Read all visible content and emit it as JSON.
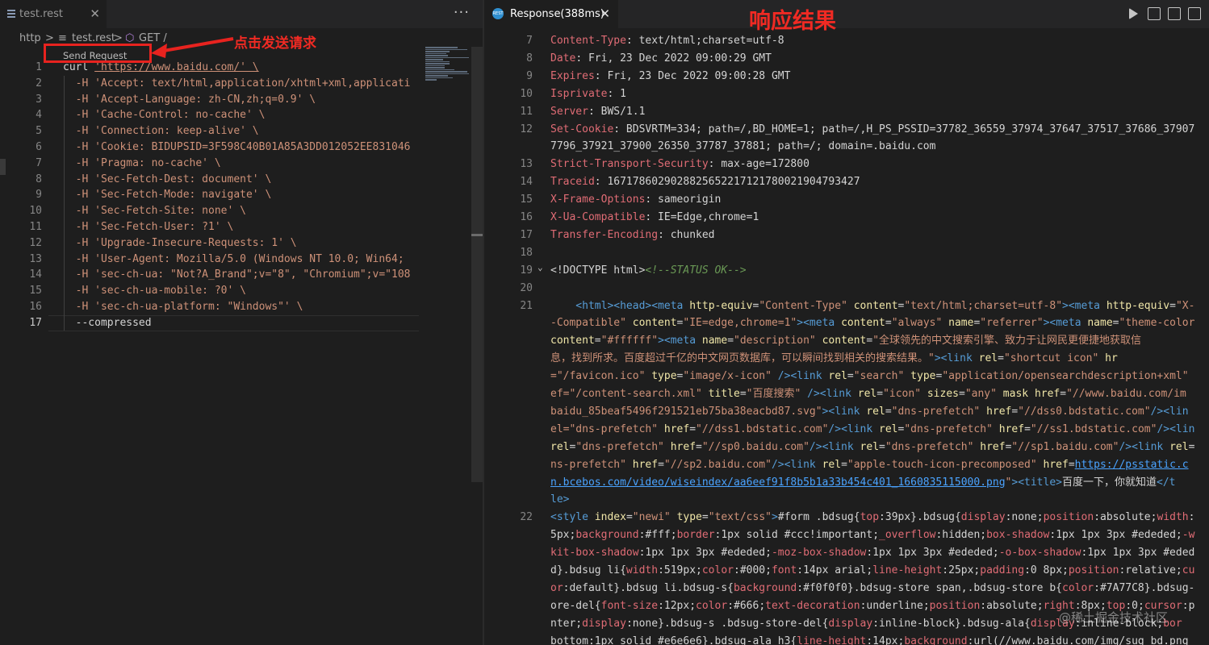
{
  "left": {
    "tab_label": "test.rest",
    "tab_close": "✕",
    "more": "···",
    "breadcrumb": [
      "http",
      ">",
      "≡",
      "test.rest",
      ">",
      "GET /"
    ],
    "codelens": "Send Request",
    "annotation": "点击发送请求",
    "lines": [
      {
        "n": "1",
        "t": "curl 'https://www.baidu.com/' \\"
      },
      {
        "n": "2",
        "t": "  -H 'Accept: text/html,application/xhtml+xml,applicati"
      },
      {
        "n": "3",
        "t": "  -H 'Accept-Language: zh-CN,zh;q=0.9' \\"
      },
      {
        "n": "4",
        "t": "  -H 'Cache-Control: no-cache' \\"
      },
      {
        "n": "5",
        "t": "  -H 'Connection: keep-alive' \\"
      },
      {
        "n": "6",
        "t": "  -H 'Cookie: BIDUPSID=3F598C40B01A85A3DD012052EE831046"
      },
      {
        "n": "7",
        "t": "  -H 'Pragma: no-cache' \\"
      },
      {
        "n": "8",
        "t": "  -H 'Sec-Fetch-Dest: document' \\"
      },
      {
        "n": "9",
        "t": "  -H 'Sec-Fetch-Mode: navigate' \\"
      },
      {
        "n": "10",
        "t": "  -H 'Sec-Fetch-Site: none' \\"
      },
      {
        "n": "11",
        "t": "  -H 'Sec-Fetch-User: ?1' \\"
      },
      {
        "n": "12",
        "t": "  -H 'Upgrade-Insecure-Requests: 1' \\"
      },
      {
        "n": "13",
        "t": "  -H 'User-Agent: Mozilla/5.0 (Windows NT 10.0; Win64;"
      },
      {
        "n": "14",
        "t": "  -H 'sec-ch-ua: \"Not?A_Brand\";v=\"8\", \"Chromium\";v=\"108"
      },
      {
        "n": "15",
        "t": "  -H 'sec-ch-ua-mobile: ?0' \\"
      },
      {
        "n": "16",
        "t": "  -H 'sec-ch-ua-platform: \"Windows\"' \\"
      },
      {
        "n": "17",
        "t": "  --compressed"
      }
    ]
  },
  "right": {
    "tab_label": "Response(388ms)",
    "tab_close": "✕",
    "rest_icon": "REST",
    "annotation": "响应结果",
    "headers": [
      {
        "n": "7",
        "k": "Content-Type",
        "v": ": text/html;charset=utf-8"
      },
      {
        "n": "8",
        "k": "Date",
        "v": ": Fri, 23 Dec 2022 09:00:29 GMT"
      },
      {
        "n": "9",
        "k": "Expires",
        "v": ": Fri, 23 Dec 2022 09:00:28 GMT"
      },
      {
        "n": "10",
        "k": "Isprivate",
        "v": ": 1"
      },
      {
        "n": "11",
        "k": "Server",
        "v": ": BWS/1.1"
      },
      {
        "n": "12",
        "k": "Set-Cookie",
        "v": ": BDSVRTM=334; path=/,BD_HOME=1; path=/,H_PS_PSSID=37782_36559_37974_37647_37517_37686_37907"
      },
      {
        "n": "",
        "k": "",
        "v": "7796_37921_37900_26350_37787_37881; path=/; domain=.baidu.com"
      },
      {
        "n": "13",
        "k": "Strict-Transport-Security",
        "v": ": max-age=172800"
      },
      {
        "n": "14",
        "k": "Traceid",
        "v": ": 1671786029028825652217121780021904793427"
      },
      {
        "n": "15",
        "k": "X-Frame-Options",
        "v": ": sameorigin"
      },
      {
        "n": "16",
        "k": "X-Ua-Compatible",
        "v": ": IE=Edge,chrome=1"
      },
      {
        "n": "17",
        "k": "Transfer-Encoding",
        "v": ": chunked"
      },
      {
        "n": "18",
        "k": "",
        "v": ""
      }
    ],
    "doctype_line": {
      "n": "19",
      "a": "<!DOCTYPE html>",
      "b": "<!--STATUS OK-->"
    },
    "empty_line": {
      "n": "20"
    },
    "html_line_no": "21",
    "html_lines": [
      [
        [
          "tag",
          "    <html>"
        ],
        [
          "tag",
          "<head>"
        ],
        [
          "tag",
          "<meta "
        ],
        [
          "attr",
          "http-equiv"
        ],
        [
          "p",
          "="
        ],
        [
          "str",
          "\"Content-Type\" "
        ],
        [
          "attr",
          "content"
        ],
        [
          "p",
          "="
        ],
        [
          "str",
          "\"text/html;charset=utf-8\""
        ],
        [
          "tag",
          ">"
        ],
        [
          "tag",
          "<meta "
        ],
        [
          "attr",
          "http-equiv"
        ],
        [
          "p",
          "="
        ],
        [
          "str",
          "\"X-"
        ]
      ],
      [
        [
          "str",
          "-Compatible\" "
        ],
        [
          "attr",
          "content"
        ],
        [
          "p",
          "="
        ],
        [
          "str",
          "\"IE=edge,chrome=1\""
        ],
        [
          "tag",
          ">"
        ],
        [
          "tag",
          "<meta "
        ],
        [
          "attr",
          "content"
        ],
        [
          "p",
          "="
        ],
        [
          "str",
          "\"always\" "
        ],
        [
          "attr",
          "name"
        ],
        [
          "p",
          "="
        ],
        [
          "str",
          "\"referrer\""
        ],
        [
          "tag",
          ">"
        ],
        [
          "tag",
          "<meta "
        ],
        [
          "attr",
          "name"
        ],
        [
          "p",
          "="
        ],
        [
          "str",
          "\"theme-color"
        ]
      ],
      [
        [
          "attr",
          "content"
        ],
        [
          "p",
          "="
        ],
        [
          "str",
          "\"#ffffff\""
        ],
        [
          "tag",
          ">"
        ],
        [
          "tag",
          "<meta "
        ],
        [
          "attr",
          "name"
        ],
        [
          "p",
          "="
        ],
        [
          "str",
          "\"description\" "
        ],
        [
          "attr",
          "content"
        ],
        [
          "p",
          "="
        ],
        [
          "str",
          "\"全球领先的中文搜索引擎、致力于让网民更便捷地获取信"
        ]
      ],
      [
        [
          "str",
          "息，找到所求。百度超过千亿的中文网页数据库，可以瞬间找到相关的搜索结果。\""
        ],
        [
          "tag",
          ">"
        ],
        [
          "tag",
          "<link "
        ],
        [
          "attr",
          "rel"
        ],
        [
          "p",
          "="
        ],
        [
          "str",
          "\"shortcut icon\" "
        ],
        [
          "attr",
          "hr"
        ]
      ],
      [
        [
          "str",
          "=\"/favicon.ico\" "
        ],
        [
          "attr",
          "type"
        ],
        [
          "p",
          "="
        ],
        [
          "str",
          "\"image/x-icon\" "
        ],
        [
          "tag",
          "/>"
        ],
        [
          "tag",
          "<link "
        ],
        [
          "attr",
          "rel"
        ],
        [
          "p",
          "="
        ],
        [
          "str",
          "\"search\" "
        ],
        [
          "attr",
          "type"
        ],
        [
          "p",
          "="
        ],
        [
          "str",
          "\"application/opensearchdescription+xml\" "
        ]
      ],
      [
        [
          "str",
          "ef=\"/content-search.xml\" "
        ],
        [
          "attr",
          "title"
        ],
        [
          "p",
          "="
        ],
        [
          "str",
          "\"百度搜索\" "
        ],
        [
          "tag",
          "/>"
        ],
        [
          "tag",
          "<link "
        ],
        [
          "attr",
          "rel"
        ],
        [
          "p",
          "="
        ],
        [
          "str",
          "\"icon\" "
        ],
        [
          "attr",
          "sizes"
        ],
        [
          "p",
          "="
        ],
        [
          "str",
          "\"any\" "
        ],
        [
          "attr",
          "mask "
        ],
        [
          "attr",
          "href"
        ],
        [
          "p",
          "="
        ],
        [
          "str",
          "\"//www.baidu.com/im"
        ]
      ],
      [
        [
          "str",
          "baidu_85beaf5496f291521eb75ba38eacbd87.svg\""
        ],
        [
          "tag",
          ">"
        ],
        [
          "tag",
          "<link "
        ],
        [
          "attr",
          "rel"
        ],
        [
          "p",
          "="
        ],
        [
          "str",
          "\"dns-prefetch\" "
        ],
        [
          "attr",
          "href"
        ],
        [
          "p",
          "="
        ],
        [
          "str",
          "\"//dss0.bdstatic.com\""
        ],
        [
          "tag",
          "/>"
        ],
        [
          "tag",
          "<lin"
        ]
      ],
      [
        [
          "str",
          "el=\"dns-prefetch\" "
        ],
        [
          "attr",
          "href"
        ],
        [
          "p",
          "="
        ],
        [
          "str",
          "\"//dss1.bdstatic.com\""
        ],
        [
          "tag",
          "/>"
        ],
        [
          "tag",
          "<link "
        ],
        [
          "attr",
          "rel"
        ],
        [
          "p",
          "="
        ],
        [
          "str",
          "\"dns-prefetch\" "
        ],
        [
          "attr",
          "href"
        ],
        [
          "p",
          "="
        ],
        [
          "str",
          "\"//ss1.bdstatic.com\""
        ],
        [
          "tag",
          "/>"
        ],
        [
          "tag",
          "<lin"
        ]
      ],
      [
        [
          "attr",
          "rel"
        ],
        [
          "p",
          "="
        ],
        [
          "str",
          "\"dns-prefetch\" "
        ],
        [
          "attr",
          "href"
        ],
        [
          "p",
          "="
        ],
        [
          "str",
          "\"//sp0.baidu.com\""
        ],
        [
          "tag",
          "/>"
        ],
        [
          "tag",
          "<link "
        ],
        [
          "attr",
          "rel"
        ],
        [
          "p",
          "="
        ],
        [
          "str",
          "\"dns-prefetch\" "
        ],
        [
          "attr",
          "href"
        ],
        [
          "p",
          "="
        ],
        [
          "str",
          "\"//sp1.baidu.com\""
        ],
        [
          "tag",
          "/>"
        ],
        [
          "tag",
          "<link "
        ],
        [
          "attr",
          "rel"
        ],
        [
          "p",
          "="
        ]
      ],
      [
        [
          "str",
          "ns-prefetch\" "
        ],
        [
          "attr",
          "href"
        ],
        [
          "p",
          "="
        ],
        [
          "str",
          "\"//sp2.baidu.com\""
        ],
        [
          "tag",
          "/>"
        ],
        [
          "tag",
          "<link "
        ],
        [
          "attr",
          "rel"
        ],
        [
          "p",
          "="
        ],
        [
          "str",
          "\"apple-touch-icon-precomposed\" "
        ],
        [
          "attr",
          "href"
        ],
        [
          "p",
          "="
        ],
        [
          "url",
          "https://psstatic.c"
        ]
      ],
      [
        [
          "url",
          "n.bcebos.com/video/wiseindex/aa6eef91f8b5b1a33b454c401_1660835115000.png"
        ],
        [
          "str",
          "\""
        ],
        [
          "tag",
          ">"
        ],
        [
          "tag",
          "<title>"
        ],
        [
          "p",
          "百度一下，你就知道"
        ],
        [
          "tag",
          "</t"
        ]
      ],
      [
        [
          "tag",
          "le>"
        ]
      ]
    ],
    "css_line_no": "22",
    "css_lines": [
      [
        [
          "tag",
          "<style "
        ],
        [
          "attr",
          "index"
        ],
        [
          "p",
          "="
        ],
        [
          "str",
          "\"newi\" "
        ],
        [
          "attr",
          "type"
        ],
        [
          "p",
          "="
        ],
        [
          "str",
          "\"text/css\""
        ],
        [
          "tag",
          ">"
        ],
        [
          "p",
          "#form .bdsug{"
        ],
        [
          "prop",
          "top"
        ],
        [
          "p",
          ":39px}.bdsug{"
        ],
        [
          "prop",
          "display"
        ],
        [
          "p",
          ":none;"
        ],
        [
          "prop",
          "position"
        ],
        [
          "p",
          ":absolute;"
        ],
        [
          "prop",
          "width"
        ],
        [
          "p",
          ":"
        ]
      ],
      [
        [
          "p",
          "5px;"
        ],
        [
          "prop",
          "background"
        ],
        [
          "p",
          ":#fff;"
        ],
        [
          "prop",
          "border"
        ],
        [
          "p",
          ":1px solid #ccc!important;"
        ],
        [
          "prop",
          "_overflow"
        ],
        [
          "p",
          ":hidden;"
        ],
        [
          "prop",
          "box-shadow"
        ],
        [
          "p",
          ":1px 1px 3px #ededed;"
        ],
        [
          "prop",
          "-w"
        ]
      ],
      [
        [
          "prop",
          "kit-box-shadow"
        ],
        [
          "p",
          ":1px 1px 3px #ededed;"
        ],
        [
          "prop",
          "-moz-box-shadow"
        ],
        [
          "p",
          ":1px 1px 3px #ededed;"
        ],
        [
          "prop",
          "-o-box-shadow"
        ],
        [
          "p",
          ":1px 1px 3px #eded"
        ]
      ],
      [
        [
          "p",
          "d}.bdsug li{"
        ],
        [
          "prop",
          "width"
        ],
        [
          "p",
          ":519px;"
        ],
        [
          "prop",
          "color"
        ],
        [
          "p",
          ":#000;"
        ],
        [
          "prop",
          "font"
        ],
        [
          "p",
          ":14px arial;"
        ],
        [
          "prop",
          "line-height"
        ],
        [
          "p",
          ":25px;"
        ],
        [
          "prop",
          "padding"
        ],
        [
          "p",
          ":0 8px;"
        ],
        [
          "prop",
          "position"
        ],
        [
          "p",
          ":relative;"
        ],
        [
          "prop",
          "cu"
        ]
      ],
      [
        [
          "prop",
          "or"
        ],
        [
          "p",
          ":default}.bdsug li.bdsug-s{"
        ],
        [
          "prop",
          "background"
        ],
        [
          "p",
          ":#f0f0f0}.bdsug-store span,.bdsug-store b{"
        ],
        [
          "prop",
          "color"
        ],
        [
          "p",
          ":#7A77C8}.bdsug-"
        ]
      ],
      [
        [
          "p",
          "ore-del{"
        ],
        [
          "prop",
          "font-size"
        ],
        [
          "p",
          ":12px;"
        ],
        [
          "prop",
          "color"
        ],
        [
          "p",
          ":#666;"
        ],
        [
          "prop",
          "text-decoration"
        ],
        [
          "p",
          ":underline;"
        ],
        [
          "prop",
          "position"
        ],
        [
          "p",
          ":absolute;"
        ],
        [
          "prop",
          "right"
        ],
        [
          "p",
          ":8px;"
        ],
        [
          "prop",
          "top"
        ],
        [
          "p",
          ":0;"
        ],
        [
          "prop",
          "cursor"
        ],
        [
          "p",
          ":p"
        ]
      ],
      [
        [
          "p",
          "nter;"
        ],
        [
          "prop",
          "display"
        ],
        [
          "p",
          ":none}.bdsug-s .bdsug-store-del{"
        ],
        [
          "prop",
          "display"
        ],
        [
          "p",
          ":inline-block}.bdsug-ala{"
        ],
        [
          "prop",
          "display"
        ],
        [
          "p",
          ":inline-block;"
        ],
        [
          "prop",
          "bor"
        ]
      ],
      [
        [
          "p",
          "bottom:1px solid #e6e6e6}.bdsug-ala h3{"
        ],
        [
          "prop",
          "line-height"
        ],
        [
          "p",
          ":14px;"
        ],
        [
          "prop",
          "background"
        ],
        [
          "p",
          ":url(//www.baidu.com/img/sug_bd.png"
        ]
      ]
    ],
    "watermark": "@稀土掘金技术社区"
  }
}
